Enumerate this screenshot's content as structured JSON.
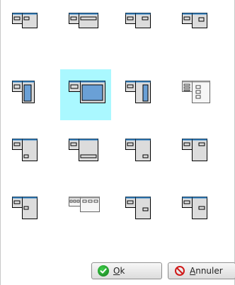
{
  "icons": {
    "r1": [
      "layout-icon-1",
      "layout-icon-2",
      "layout-icon-3",
      "layout-icon-4"
    ],
    "r2": [
      "layout-icon-5",
      "layout-icon-6",
      "layout-icon-7",
      "layout-icon-8"
    ],
    "r3": [
      "layout-icon-9",
      "layout-icon-10",
      "layout-icon-11",
      "layout-icon-12"
    ],
    "r4": [
      "layout-icon-13",
      "layout-icon-14",
      "layout-icon-15",
      "layout-icon-16"
    ]
  },
  "selected_layout": "layout-icon-6",
  "colors": {
    "title_bar": "#2f7fc1",
    "window_fill": "#dcdcdc",
    "selected_fill": "#6aa0d6",
    "selection_bg": "#aaf8ff"
  },
  "buttons": {
    "ok_label": "Ok",
    "cancel_label": "Annuler"
  }
}
